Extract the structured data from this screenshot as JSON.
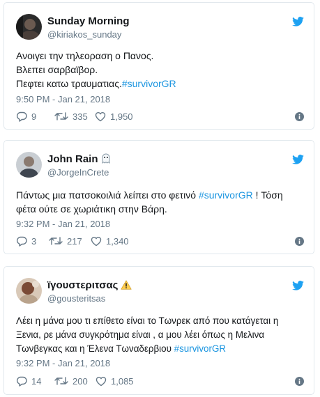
{
  "tweets": [
    {
      "author_name": "Sunday Morning",
      "author_handle": "@kiriakos_sunday",
      "lines": [
        "Ανοιγει την τηλεοραση ο Πανος.",
        "Βλεπει σαρβαϊβορ."
      ],
      "last_line_text": "Πεφτει κατω τραυματιας.",
      "hashtag": "#survivorGR",
      "timestamp": "9:50 PM - Jan 21, 2018",
      "replies": "9",
      "retweets": "335",
      "likes": "1,950"
    },
    {
      "author_name": "John Rain",
      "author_handle": "@JorgeInCrete",
      "line1_prefix": "Πάντως μια πατσοκοιλιά λείπει στο φετινό ",
      "hashtag": "#survivorGR",
      "line1_suffix": " ! Τόση",
      "line2": "φέτα ούτε σε χωριάτικη στην Βάρη.",
      "timestamp": "9:32 PM - Jan 21, 2018",
      "replies": "3",
      "retweets": "217",
      "likes": "1,340"
    },
    {
      "author_name": "ïγουστεριτσας",
      "author_handle": "@gousteritsas",
      "lines": [
        "Λέει η μάνα μου τι επίθετο είναι το Τωνρεκ από που κατάγεται η",
        "Ξενια, ρε μάνα συγκρότημα είναι , α μου λέει όπως η Μελινα"
      ],
      "last_line_text": "Τωνβεγκας και η Έλενα Τωναδερβιου ",
      "hashtag": "#survivorGR",
      "timestamp": "9:32 PM - Jan 21, 2018",
      "replies": "14",
      "retweets": "200",
      "likes": "1,085"
    }
  ],
  "colors": {
    "text": "#14171a",
    "muted": "#657786",
    "link": "#1b95e0",
    "twitter_blue": "#1da1f2",
    "border": "#e1e8ed"
  },
  "icons": [
    "twitter-bird-icon",
    "reply-icon",
    "retweet-icon",
    "like-icon",
    "info-icon",
    "ghost-emoji-icon",
    "warning-emoji-icon"
  ]
}
